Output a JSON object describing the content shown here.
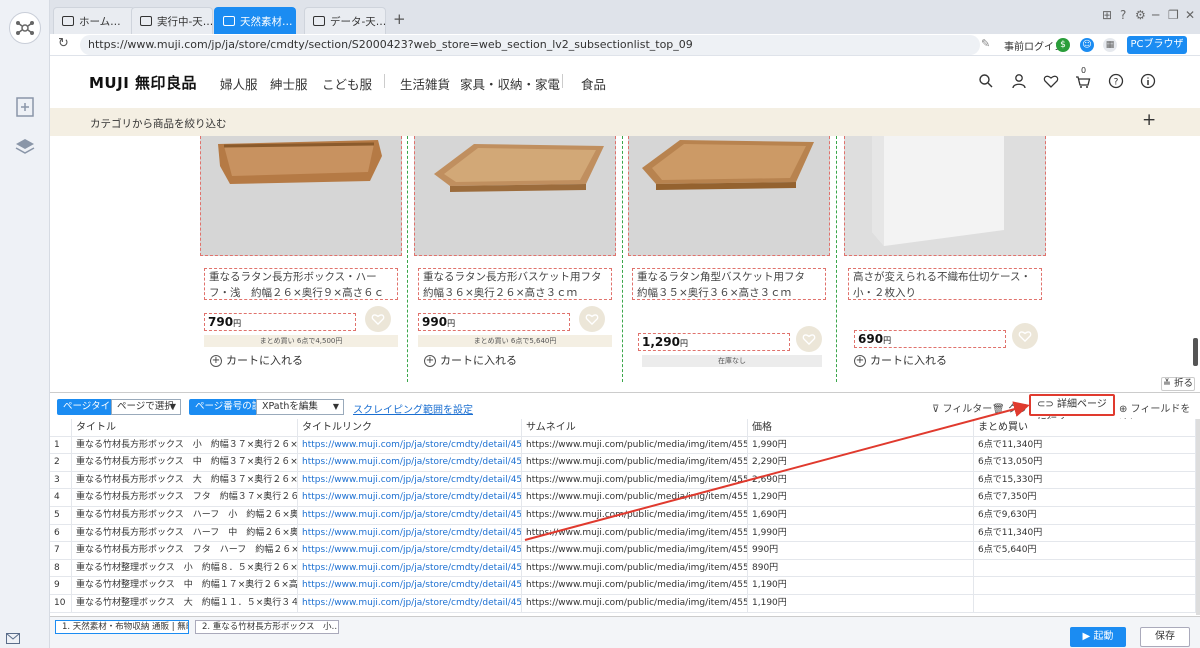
{
  "tabs": [
    {
      "label": "ホーム…",
      "active": false
    },
    {
      "label": "実行中-天…",
      "active": false
    },
    {
      "label": "天然素材…",
      "active": true
    },
    {
      "label": "データ-天…",
      "active": false
    }
  ],
  "address": {
    "url": "https://www.muji.com/jp/ja/store/cmdty/section/S2000423?web_store=web_section_lv2_subsectionlist_top_09",
    "login": "事前ログイン",
    "browser_mode": "PCブラウザ"
  },
  "muji": {
    "logo": "MUJI 無印良品",
    "nav": [
      "婦人服",
      "紳士服",
      "こども服",
      "生活雑貨",
      "家具・収納・家電",
      "食品"
    ],
    "filter": "カテゴリから商品を絞り込む",
    "cart_count": "0"
  },
  "products": [
    {
      "title": "重なるラタン長方形ボックス・ハーフ・浅　約幅２６×奥行９×高さ６ｃｍ",
      "price": "790",
      "unit": "円",
      "note": "まとめ買い 6点で4,500円",
      "cart": "カートに入れる"
    },
    {
      "title": "重なるラタン長方形バスケット用フタ　約幅３６×奥行２６×高さ３ｃｍ",
      "price": "990",
      "unit": "円",
      "note": "まとめ買い 6点で5,640円",
      "cart": "カートに入れる"
    },
    {
      "title": "重なるラタン角型バスケット用フタ　約幅３５×奥行３６×高さ３ｃｍ",
      "price": "1,290",
      "unit": "円",
      "note": "在庫なし",
      "cart": ""
    },
    {
      "title": "高さが変えられる不織布仕切ケース・小・２枚入り",
      "price": "690",
      "unit": "円",
      "note": "",
      "cart": "カートに入れる"
    }
  ],
  "fold_label": "折る",
  "toolbar": {
    "page_type_label": "ページタイプ",
    "page_type_value": "ページで選択",
    "page_num_label": "ページ番号の設定",
    "page_num_value": "XPathを編集",
    "scrape_link": "スクレイピング範囲を設定",
    "filter": "フィルター",
    "clear": "クリア",
    "detail": "詳細ページに行く",
    "add_field": "フィールドを追加"
  },
  "table": {
    "headers": [
      "タイトル",
      "タイトルリンク",
      "サムネイル",
      "価格",
      "まとめ買い"
    ],
    "rows": [
      {
        "n": "1",
        "title": "重なる竹材長方形ボックス　小　約幅３７×奥行２６×高さ８…",
        "link": "https://www.muji.com/jp/ja/store/cmdty/detail/4550512047315",
        "thumb": "https://www.muji.com/public/media/img/item/4550512047315_4…",
        "price": "1,990円",
        "bulk": "6点で11,340円"
      },
      {
        "n": "2",
        "title": "重なる竹材長方形ボックス　中　約幅３７×奥行２６×高さ１…",
        "link": "https://www.muji.com/jp/ja/store/cmdty/detail/4550512047308",
        "thumb": "https://www.muji.com/public/media/img/item/4550512047308_4…",
        "price": "2,290円",
        "bulk": "6点で13,050円"
      },
      {
        "n": "3",
        "title": "重なる竹材長方形ボックス　大　約幅３７×奥行２６×高さ２…",
        "link": "https://www.muji.com/jp/ja/store/cmdty/detail/4550512047292",
        "thumb": "https://www.muji.com/public/media/img/item/4550512047292_4…",
        "price": "2,690円",
        "bulk": "6点で15,330円"
      },
      {
        "n": "4",
        "title": "重なる竹材長方形ボックス　フタ　約幅３７×奥行２６×高さ…",
        "link": "https://www.muji.com/jp/ja/store/cmdty/detail/4550512047278",
        "thumb": "https://www.muji.com/public/media/img/item/4550512047278_4…",
        "price": "1,290円",
        "bulk": "6点で7,350円"
      },
      {
        "n": "5",
        "title": "重なる竹材長方形ボックス　ハーフ　小　約幅２６×奥行１８…",
        "link": "https://www.muji.com/jp/ja/store/cmdty/detail/4550512047261",
        "thumb": "https://www.muji.com/public/media/img/item/4550512047261_4…",
        "price": "1,690円",
        "bulk": "6点で9,630円"
      },
      {
        "n": "6",
        "title": "重なる竹材長方形ボックス　ハーフ　中　約幅２６×奥行１８…",
        "link": "https://www.muji.com/jp/ja/store/cmdty/detail/4550512047254",
        "thumb": "https://www.muji.com/public/media/img/item/4550512047254_4…",
        "price": "1,990円",
        "bulk": "6点で11,340円"
      },
      {
        "n": "7",
        "title": "重なる竹材長方形ボックス　フタ　ハーフ　約幅２６×奥行１…",
        "link": "https://www.muji.com/jp/ja/store/cmdty/detail/4550512047285",
        "thumb": "https://www.muji.com/public/media/img/item/4550512047285_4…",
        "price": "990円",
        "bulk": "6点で5,640円"
      },
      {
        "n": "8",
        "title": "重なる竹材整理ボックス　小　約幅８．５×奥行２６×高さ５…",
        "link": "https://www.muji.com/jp/ja/store/cmdty/detail/4550512057871",
        "thumb": "https://www.muji.com/public/media/img/item/4550512057871_4…",
        "price": "890円",
        "bulk": ""
      },
      {
        "n": "9",
        "title": "重なる竹材整理ボックス　中　約幅１７×奥行２６×高さ５…",
        "link": "https://www.muji.com/jp/ja/store/cmdty/detail/4550512057888",
        "thumb": "https://www.muji.com/public/media/img/item/4550512057888_4…",
        "price": "1,190円",
        "bulk": ""
      },
      {
        "n": "10",
        "title": "重なる竹材整理ボックス　大　約幅１１．５×奥行３４×高さ…",
        "link": "https://www.muji.com/jp/ja/store/cmdty/detail/4550512057895",
        "thumb": "https://www.muji.com/public/media/img/item/4550512057895_4…",
        "price": "1,190円",
        "bulk": ""
      }
    ]
  },
  "bottom_tabs": [
    "1. 天然素材・布物収納 通販 | 無印…",
    "2. 重なる竹材長方形ボックス　小…"
  ],
  "run_label": "起動",
  "save_label": "保存",
  "colors": {
    "accent": "#1b8cf2",
    "highlight": "#e03a2e",
    "filter_bg": "#f4efe3"
  }
}
